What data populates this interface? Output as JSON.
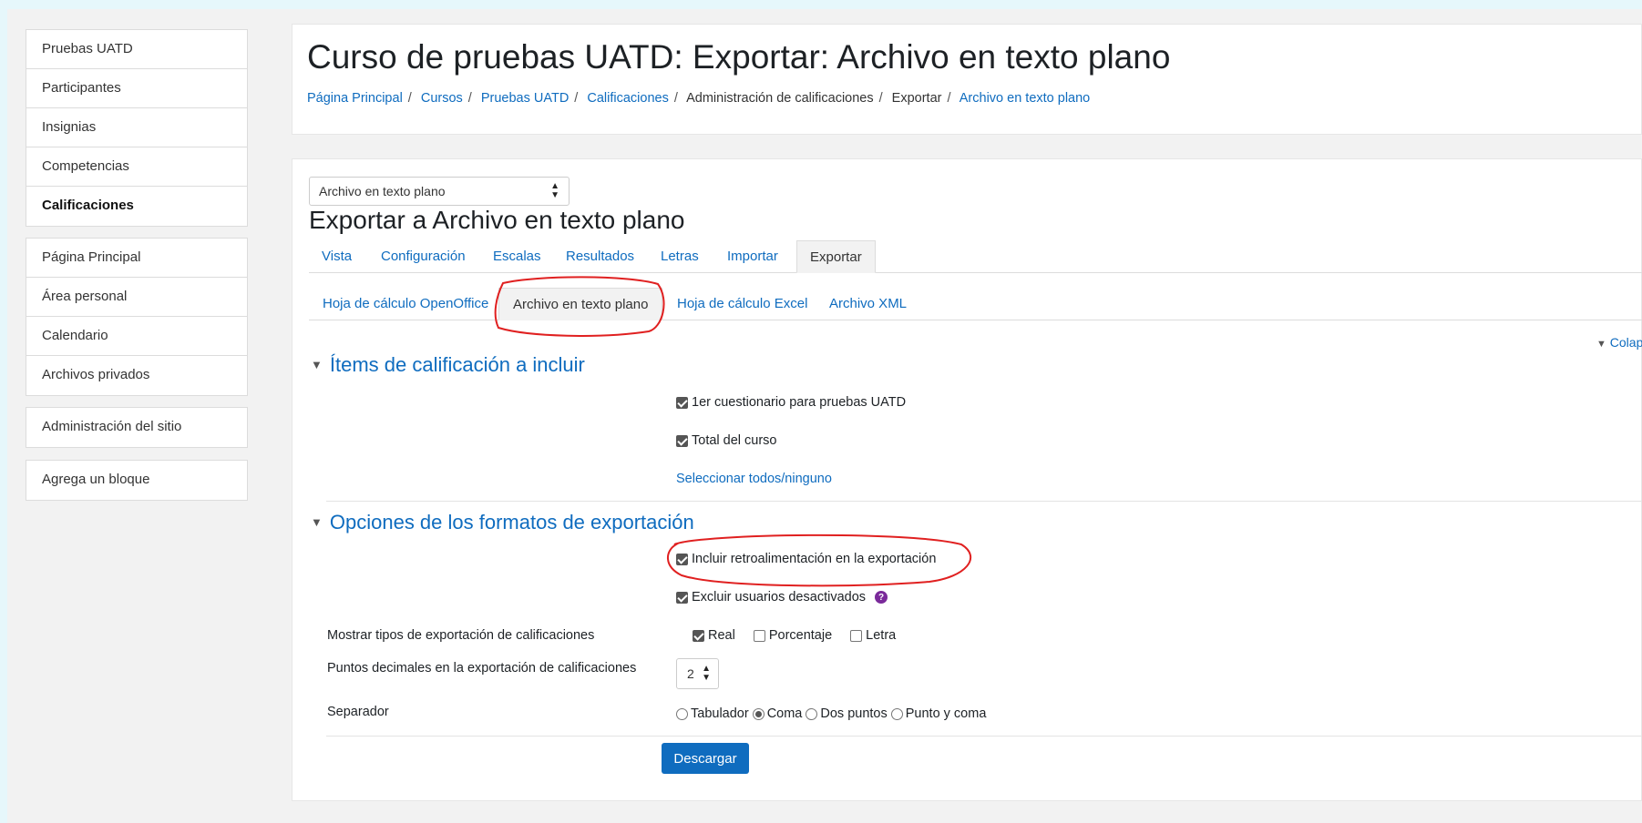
{
  "sidebar": {
    "group1": [
      "Pruebas UATD",
      "Participantes",
      "Insignias",
      "Competencias",
      "Calificaciones"
    ],
    "group2": [
      "Página Principal",
      "Área personal",
      "Calendario",
      "Archivos privados"
    ],
    "admin": "Administración del sitio",
    "add_block": "Agrega un bloque"
  },
  "header": {
    "title": "Curso de pruebas UATD: Exportar: Archivo en texto plano",
    "breadcrumb": [
      "Página Principal",
      "Cursos",
      "Pruebas UATD",
      "Calificaciones",
      "Administración de calificaciones",
      "Exportar",
      "Archivo en texto plano"
    ]
  },
  "main": {
    "format_select": "Archivo en texto plano",
    "heading": "Exportar a Archivo en texto plano",
    "tabs": [
      "Vista",
      "Configuración",
      "Escalas",
      "Resultados",
      "Letras",
      "Importar",
      "Exportar"
    ],
    "subtabs": [
      "Hoja de cálculo OpenOffice",
      "Archivo en texto plano",
      "Hoja de cálculo Excel",
      "Archivo XML"
    ],
    "collapse_all": "Colap",
    "section1": {
      "title": "Ítems de calificación a incluir",
      "items": [
        "1er cuestionario para pruebas UATD",
        "Total del curso"
      ],
      "select_all": "Seleccionar todos/ninguno"
    },
    "section2": {
      "title": "Opciones de los formatos de exportación",
      "include_feedback": "Incluir retroalimentación en la exportación",
      "exclude_suspended": "Excluir usuarios desactivados",
      "display_types_label": "Mostrar tipos de exportación de calificaciones",
      "display_types": [
        "Real",
        "Porcentaje",
        "Letra"
      ],
      "decimals_label": "Puntos decimales en la exportación de calificaciones",
      "decimals_value": "2",
      "separator_label": "Separador",
      "separators": [
        "Tabulador",
        "Coma",
        "Dos puntos",
        "Punto y coma"
      ]
    },
    "download": "Descargar"
  },
  "colors": {
    "link": "#0f6cbf",
    "annotation": "#e02020",
    "help": "#7a2a9a"
  }
}
